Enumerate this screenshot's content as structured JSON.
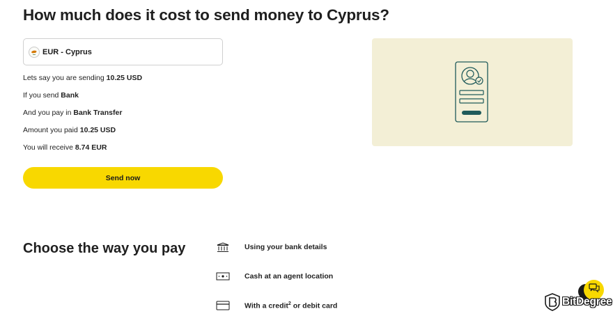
{
  "page": {
    "title": "How much does it cost to send money to Cyprus?"
  },
  "selector": {
    "value": "EUR - Cyprus",
    "flag_icon": "cyprus-flag-icon"
  },
  "details": [
    {
      "prefix": "Lets say you are sending",
      "value": "10.25 USD"
    },
    {
      "prefix": "If you send",
      "value": "Bank"
    },
    {
      "prefix": "And you pay in",
      "value": "Bank Transfer"
    },
    {
      "prefix": "Amount you paid",
      "value": "10.25 USD"
    },
    {
      "prefix": "You will receive",
      "value": "8.74 EUR"
    }
  ],
  "send_button": {
    "label": "Send now"
  },
  "pay_section": {
    "title": "Choose the way you pay",
    "options": [
      {
        "icon": "bank-icon",
        "label": "Using your bank details"
      },
      {
        "icon": "cash-icon",
        "label": "Cash at an agent location"
      },
      {
        "icon": "card-icon",
        "label": "With a credit",
        "superscript": "2",
        "label_suffix": " or debit card"
      }
    ]
  },
  "logo": {
    "text": "BitDegree"
  },
  "colors": {
    "accent": "#f8d800",
    "illustration_bg": "#f3efd6",
    "illustration_line": "#1f5a5a",
    "text": "#1a1a1a"
  }
}
